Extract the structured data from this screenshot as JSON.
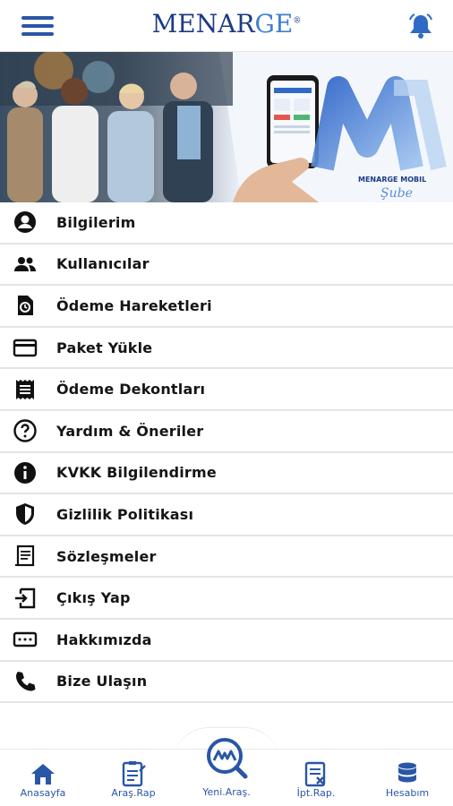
{
  "header": {
    "logo_main": "MENAR",
    "logo_accent": "GE",
    "logo_mark": "®"
  },
  "banner": {
    "brand_text": "MENARGE MOBIL",
    "brand_script": "Şube"
  },
  "menu": {
    "items": [
      {
        "label": "Bilgilerim",
        "icon": "account-circle-icon"
      },
      {
        "label": "Kullanıcılar",
        "icon": "users-icon"
      },
      {
        "label": "Ödeme Hareketleri",
        "icon": "payment-history-icon"
      },
      {
        "label": "Paket Yükle",
        "icon": "credit-card-icon"
      },
      {
        "label": "Ödeme Dekontları",
        "icon": "receipt-icon"
      },
      {
        "label": "Yardım & Öneriler",
        "icon": "help-icon"
      },
      {
        "label": "KVKK Bilgilendirme",
        "icon": "info-icon"
      },
      {
        "label": "Gizlilik Politikası",
        "icon": "shield-icon"
      },
      {
        "label": "Sözleşmeler",
        "icon": "contract-icon"
      },
      {
        "label": "Çıkış Yap",
        "icon": "logout-icon"
      },
      {
        "label": "Hakkımızda",
        "icon": "about-icon"
      },
      {
        "label": "Bize Ulaşın",
        "icon": "phone-icon"
      }
    ]
  },
  "bottom_nav": {
    "items": [
      {
        "label": "Anasayfa",
        "icon": "home-icon"
      },
      {
        "label": "Araş.Rap",
        "icon": "report-icon"
      },
      {
        "label": "Yeni.Araş.",
        "icon": "new-search-icon"
      },
      {
        "label": "İpt.Rap.",
        "icon": "cancel-report-icon"
      },
      {
        "label": "Hesabım",
        "icon": "database-icon"
      }
    ]
  },
  "colors": {
    "brand_dark": "#1d3b85",
    "brand_light": "#3e7fd4",
    "nav_blue": "#2a56a6"
  }
}
